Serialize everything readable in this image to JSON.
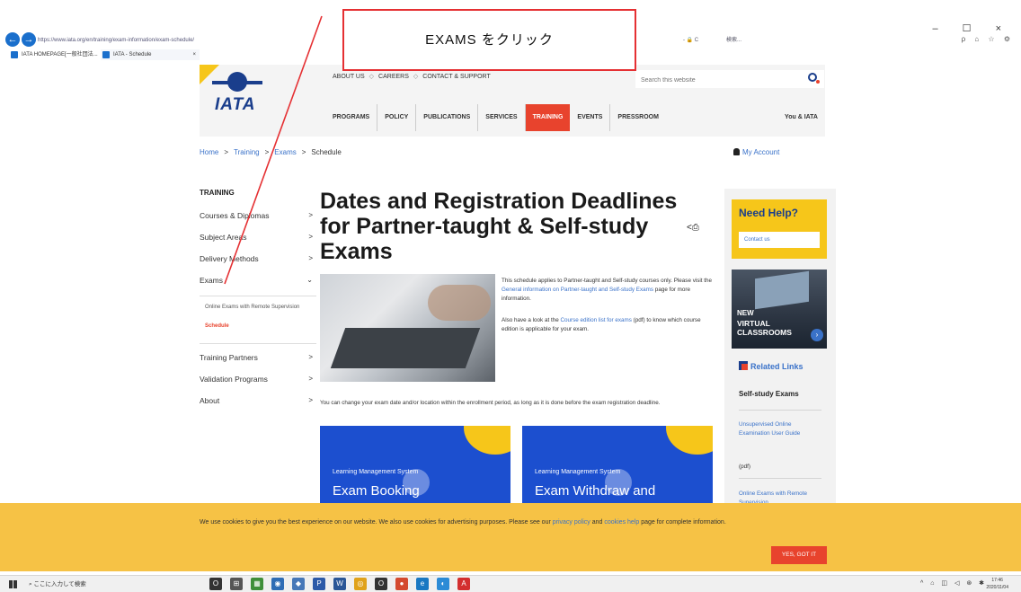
{
  "browser": {
    "address": "https://www.iata.org/en/training/exam-information/exam-schedule/",
    "address_right": "- 🔒 C",
    "search_label": "検索...",
    "tabs": [
      {
        "label": "IATA HOMEPAGE[一般社団法..."
      },
      {
        "label": "IATA - Schedule"
      }
    ],
    "window_controls": "– ☐ ×",
    "right_icons": "ρ ⌂ ☆ ⚙"
  },
  "header": {
    "logo_text": "IATA",
    "top_links": [
      "ABOUT US",
      "CAREERS",
      "CONTACT & SUPPORT"
    ],
    "top_link_sep": "◇",
    "search_placeholder": "Search this website",
    "nav": [
      "PROGRAMS",
      "POLICY",
      "PUBLICATIONS",
      "SERVICES",
      "TRAINING",
      "EVENTS",
      "PRESSROOM"
    ],
    "you_iata": "You & IATA"
  },
  "breadcrumb": {
    "items": [
      "Home",
      "Training",
      "Exams",
      "Schedule"
    ],
    "sep": ">",
    "my_account": "My Account"
  },
  "sidebar": {
    "title": "TRAINING",
    "items": [
      {
        "label": "Courses & Diplomas",
        "chev": ">"
      },
      {
        "label": "Subject Areas",
        "chev": ">"
      },
      {
        "label": "Delivery Methods",
        "chev": ">"
      },
      {
        "label": "Exams",
        "chev": "⌄"
      }
    ],
    "sub_items": [
      "Online Exams with Remote Supervision",
      "Schedule"
    ],
    "items_after": [
      {
        "label": "Training Partners",
        "chev": ">"
      },
      {
        "label": "Validation Programs",
        "chev": ">"
      },
      {
        "label": "About",
        "chev": ">"
      }
    ]
  },
  "main": {
    "title": "Dates and Registration Deadlines for Partner-taught & Self-study Exams",
    "share_icon": "<⎙",
    "para1_a": "This schedule applies to Partner-taught and Self-study courses only. Please visit the ",
    "para1_link": "General information on Partner-taught and Self-study Exams",
    "para1_b": " page for more information.",
    "para2_a": "Also have a look at the ",
    "para2_link": "Course edition list for exams",
    "para2_b": " (pdf) to know which course edition is applicable for your exam.",
    "para3": "You can change your exam date and/or location within the enrollment period, as long as it is done before the exam registration deadline.",
    "cards": [
      {
        "system": "Learning Management System",
        "title": "Exam Booking"
      },
      {
        "system": "Learning Management System",
        "title": "Exam Withdraw and"
      }
    ]
  },
  "right": {
    "need_help": "Need Help?",
    "contact_us": "Contact us",
    "vc_new": "NEW",
    "vc_label": "VIRTUAL CLASSROOMS",
    "vc_arrow": "›",
    "related_links": "Related Links",
    "rl_sub": "Self-study Exams",
    "rl_link1": "Unsupervised Online Examination User Guide",
    "rl_pdf": "(pdf)",
    "rl_link2": "Online Exams with Remote Supervision"
  },
  "cookie": {
    "text_a": "We use cookies to give you the best experience on our website. We also use cookies for advertising purposes. Please see our ",
    "link1": "privacy policy",
    "text_b": " and ",
    "link2": "cookies help",
    "text_c": " page for complete information.",
    "button": "YES, GOT IT"
  },
  "taskbar": {
    "search": "ここに入力して検索",
    "apps": [
      {
        "glyph": "O",
        "color": "#333333"
      },
      {
        "glyph": "⊞",
        "color": "#555555"
      },
      {
        "glyph": "▦",
        "color": "#3f8f3a"
      },
      {
        "glyph": "◉",
        "color": "#2f6db5"
      },
      {
        "glyph": "◆",
        "color": "#4778b8"
      },
      {
        "glyph": "P",
        "color": "#2c5aa8"
      },
      {
        "glyph": "W",
        "color": "#2b5797"
      },
      {
        "glyph": "◎",
        "color": "#e0a21a"
      },
      {
        "glyph": "O",
        "color": "#333333"
      },
      {
        "glyph": "●",
        "color": "#d44a2f"
      },
      {
        "glyph": "e",
        "color": "#1a78c2"
      },
      {
        "glyph": "◐",
        "color": "#2b8bd6"
      },
      {
        "glyph": "A",
        "color": "#d32f2f"
      }
    ],
    "tray": "^ ⌂ ◫ ◁ ⊛ ✱",
    "time": "17:46",
    "date": "2020/11/04"
  },
  "annotation": {
    "text": "EXAMS をクリック"
  }
}
